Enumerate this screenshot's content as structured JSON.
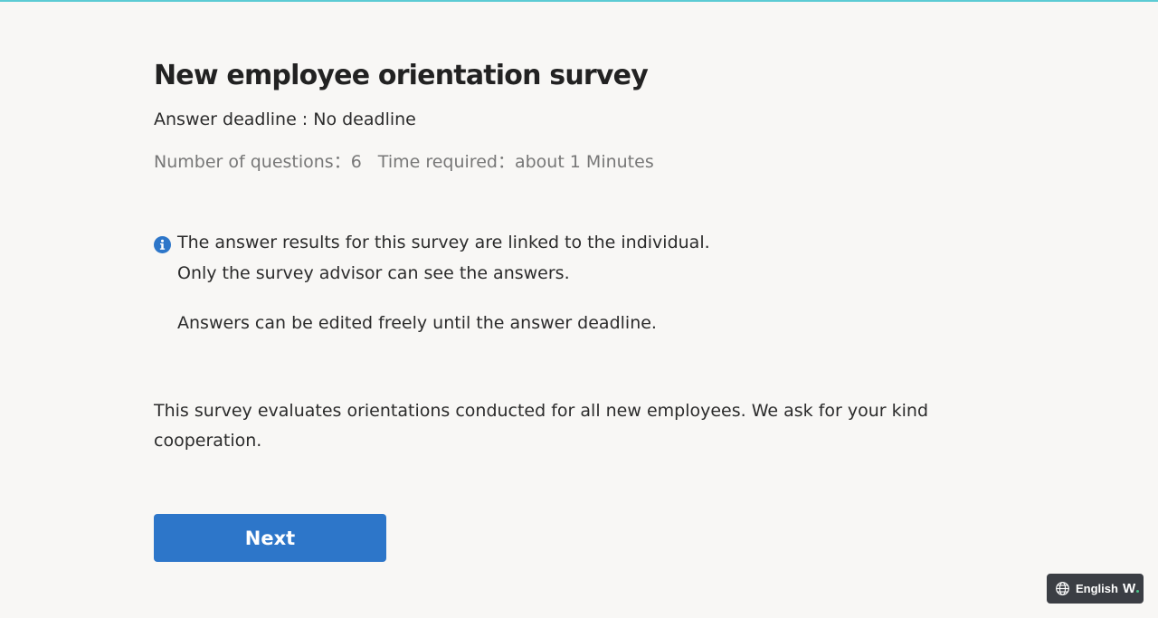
{
  "survey": {
    "title": "New employee orientation survey",
    "deadline": "Answer deadline : No deadline",
    "question_count": "Number of questions：6",
    "time_required": "Time required：about 1 Minutes"
  },
  "notice": {
    "line1": "The answer results for this survey are linked to the individual.",
    "line2": "Only the survey advisor can see the answers.",
    "line3": "Answers can be edited freely until the answer deadline."
  },
  "description": "This survey evaluates orientations conducted for all new employees. We ask for your kind cooperation.",
  "actions": {
    "next_label": "Next"
  },
  "language_switcher": {
    "label": "English",
    "logo_text": "W"
  },
  "colors": {
    "accent": "#2d76c9",
    "top_line": "#5ccbd4",
    "switcher_bg": "#3b3e44"
  },
  "icons": {
    "info": "info-icon",
    "globe": "globe-icon"
  }
}
